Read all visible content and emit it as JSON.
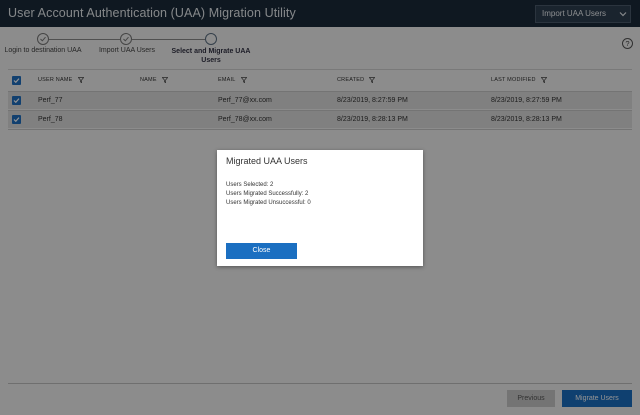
{
  "app": {
    "title": "User Account Authentication (UAA) Migration Utility",
    "dropdown_value": "Import UAA Users"
  },
  "stepper": {
    "steps": [
      {
        "label": "Login to destination UAA",
        "state": "completed"
      },
      {
        "label": "Import UAA Users",
        "state": "completed"
      },
      {
        "label": "Select and Migrate UAA Users",
        "state": "active"
      }
    ]
  },
  "help_icon": "?",
  "table": {
    "columns": [
      "USER NAME",
      "NAME",
      "EMAIL",
      "CREATED",
      "LAST MODIFIED"
    ],
    "header_checked": true,
    "rows": [
      {
        "checked": true,
        "user_name": "Perf_77",
        "name": "",
        "email": "Perf_77@xx.com",
        "created": "8/23/2019, 8:27:59 PM",
        "last_modified": "8/23/2019, 8:27:59 PM"
      },
      {
        "checked": true,
        "user_name": "Perf_78",
        "name": "",
        "email": "Perf_78@xx.com",
        "created": "8/23/2019, 8:28:13 PM",
        "last_modified": "8/23/2019, 8:28:13 PM"
      }
    ]
  },
  "footer": {
    "previous_label": "Previous",
    "migrate_label": "Migrate Users"
  },
  "modal": {
    "title": "Migrated UAA Users",
    "lines": [
      "Users Selected: 2",
      "Users Migrated Successfully: 2",
      "Users Migrated Unsuccessful: 0"
    ],
    "close_label": "Close"
  },
  "colors": {
    "titlebar": "#1b2a3a",
    "primary_button": "#1b6fc1",
    "checkbox": "#1f6fc0",
    "overlay": "rgba(0,0,0,0.42)"
  }
}
